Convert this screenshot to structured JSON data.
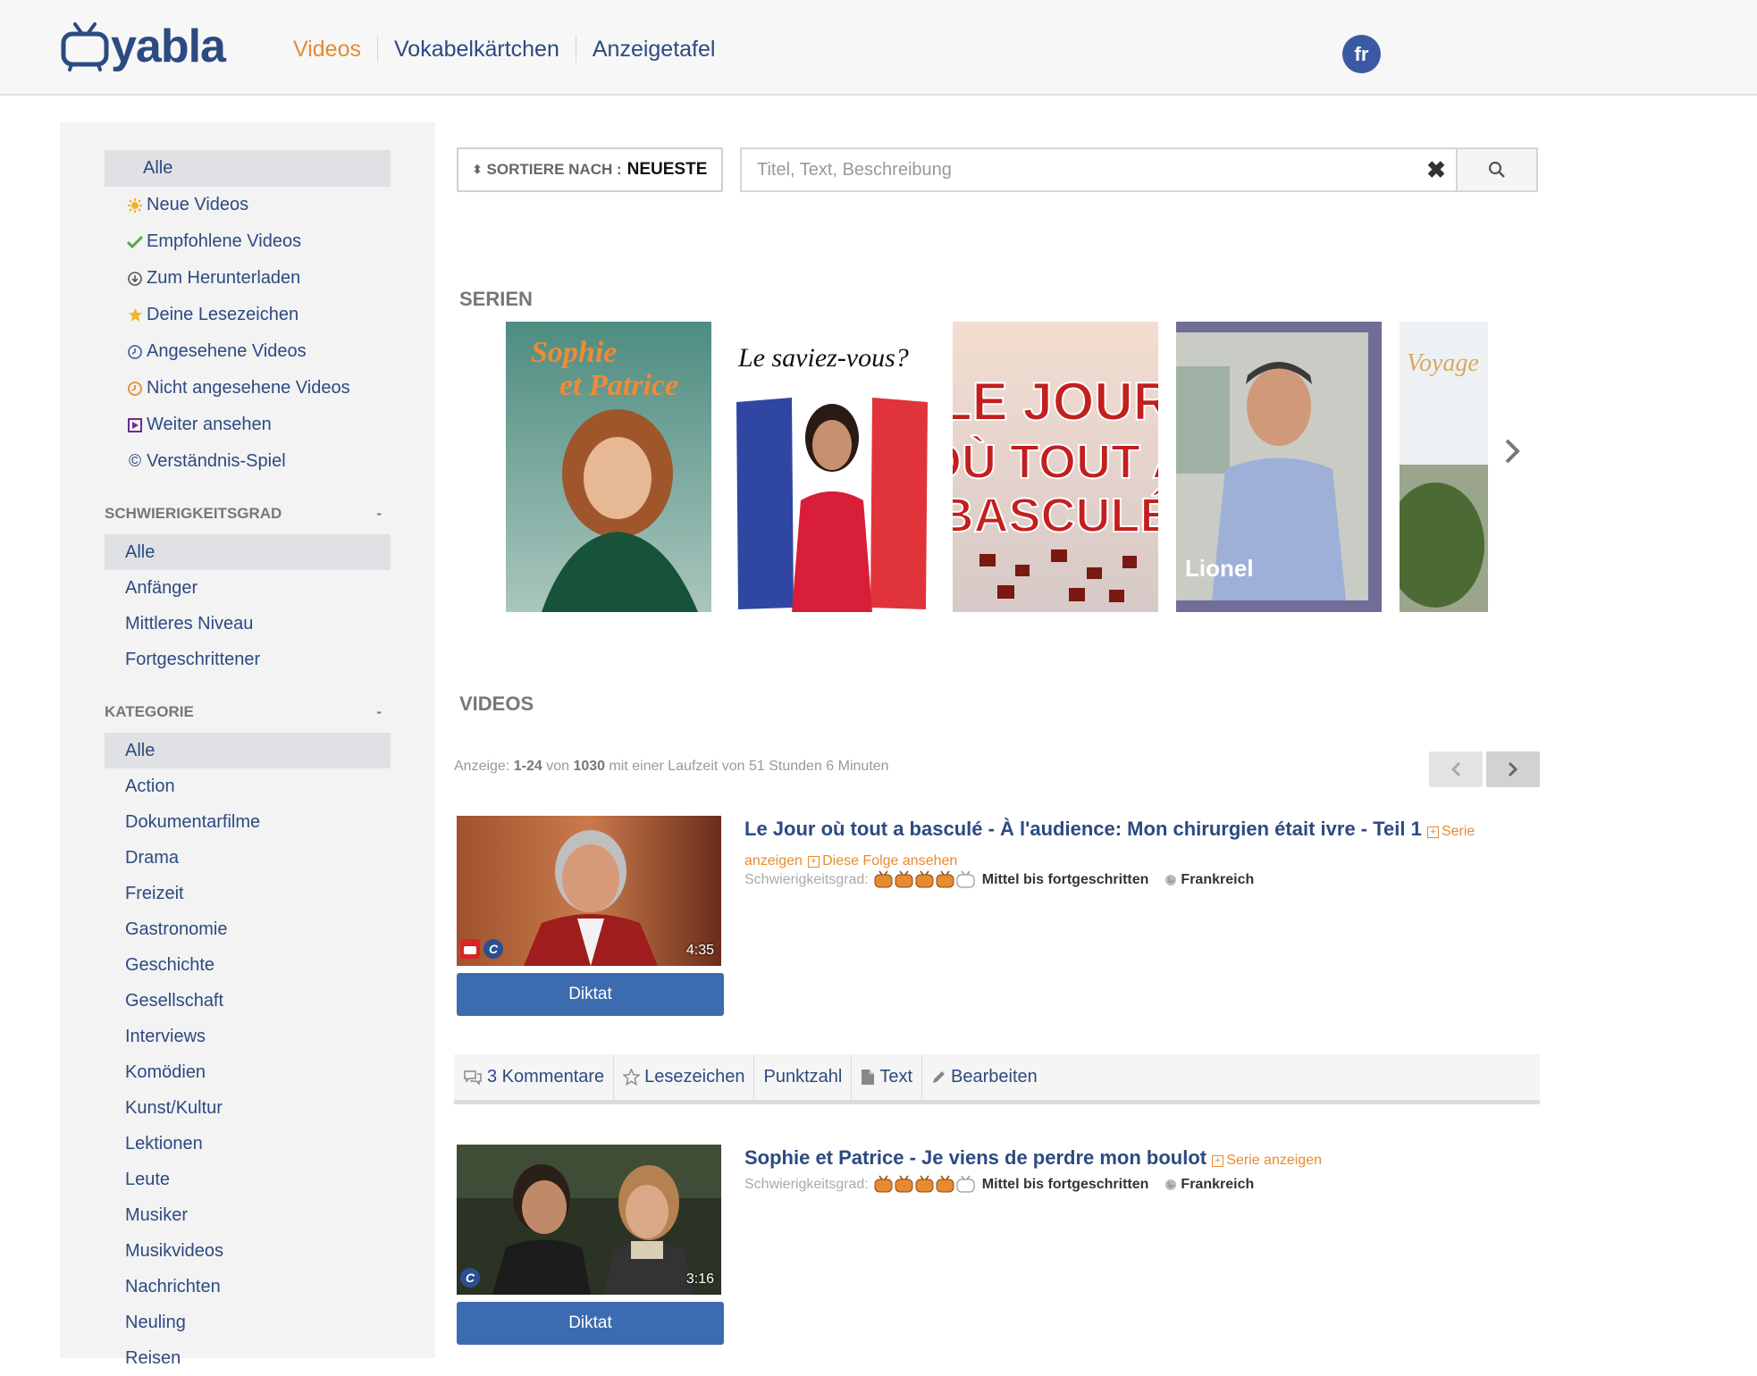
{
  "header": {
    "logo_text": "yabla",
    "nav": [
      "Videos",
      "Vokabelkärtchen",
      "Anzeigetafel"
    ],
    "language": "fr"
  },
  "sidebar": {
    "filters": [
      {
        "label": "Alle",
        "icon": "none"
      },
      {
        "label": "Neue Videos",
        "icon": "sun-icon"
      },
      {
        "label": "Empfohlene Videos",
        "icon": "check-icon"
      },
      {
        "label": "Zum Herunterladen",
        "icon": "download-icon"
      },
      {
        "label": "Deine Lesezeichen",
        "icon": "star-icon"
      },
      {
        "label": "Angesehene Videos",
        "icon": "clock-icon"
      },
      {
        "label": "Nicht angesehene Videos",
        "icon": "clock-orange-icon"
      },
      {
        "label": "Weiter ansehen",
        "icon": "play-icon"
      },
      {
        "label": "Verständnis-Spiel",
        "icon": "copyright-icon"
      }
    ],
    "difficulty_heading": "SCHWIERIGKEITSGRAD",
    "difficulty_toggle": "-",
    "difficulty": [
      "Alle",
      "Anfänger",
      "Mittleres Niveau",
      "Fortgeschrittener"
    ],
    "category_heading": "KATEGORIE",
    "category_toggle": "-",
    "categories": [
      "Alle",
      "Action",
      "Dokumentarfilme",
      "Drama",
      "Freizeit",
      "Gastronomie",
      "Geschichte",
      "Gesellschaft",
      "Interviews",
      "Komödien",
      "Kunst/Kultur",
      "Lektionen",
      "Leute",
      "Musiker",
      "Musikvideos",
      "Nachrichten",
      "Neuling",
      "Reisen"
    ]
  },
  "toolbar": {
    "sort_label": "SORTIERE NACH :",
    "sort_value": "NEUESTE",
    "search_placeholder": "Titel, Text, Beschreibung"
  },
  "series": {
    "heading": "SERIEN",
    "cards": [
      {
        "title_line1": "Sophie",
        "title_line2": "et Patrice"
      },
      {
        "title": "Le saviez-vous?"
      },
      {
        "title_line1": "LE JOUR",
        "title_line2": "OÙ TOUT A",
        "title_line3": "BASCULÉ"
      },
      {
        "caption": "Lionel"
      },
      {
        "title": "Voyage"
      }
    ]
  },
  "videos_section": {
    "heading": "VIDEOS",
    "pager_prefix": "Anzeige: ",
    "pager_range": "1-24",
    "pager_mid": " von ",
    "pager_total": "1030",
    "pager_suffix": " mit einer Laufzeit von 51 Stunden 6 Minuten"
  },
  "videos": [
    {
      "title": "Le Jour où tout a basculé - À l'audience: Mon chirurgien était ivre - Teil 1",
      "link_series": "Serie anzeigen",
      "link_episode": "Diese Folge ansehen",
      "difficulty_label": "Schwierigkeitsgrad:",
      "difficulty_level": 4,
      "difficulty_text": "Mittel bis fortgeschritten",
      "country": "Frankreich",
      "duration": "4:35",
      "button": "Diktat"
    },
    {
      "title": "Sophie et Patrice - Je viens de perdre mon boulot",
      "link_series": "Serie anzeigen",
      "difficulty_label": "Schwierigkeitsgrad:",
      "difficulty_level": 4,
      "difficulty_text": "Mittel bis fortgeschritten",
      "country": "Frankreich",
      "duration": "3:16",
      "button": "Diktat"
    }
  ],
  "actions": [
    "3 Kommentare",
    "Lesezeichen",
    "Punktzahl",
    "Text",
    "Bearbeiten"
  ],
  "colors": {
    "brand": "#2c4a82",
    "accent": "#e88a31",
    "button": "#3d6bb0"
  }
}
